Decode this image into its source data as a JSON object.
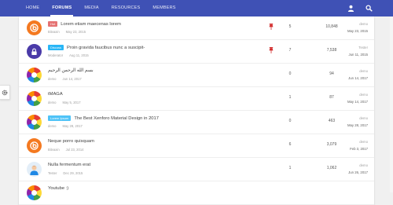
{
  "nav": {
    "items": [
      {
        "label": "HOME",
        "active": false
      },
      {
        "label": "FORUMS",
        "active": true
      },
      {
        "label": "MEDIA",
        "active": false
      },
      {
        "label": "RESOURCES",
        "active": false
      },
      {
        "label": "MEMBERS",
        "active": false
      }
    ],
    "icons": [
      "user-icon",
      "search-icon"
    ]
  },
  "side_toggle_icon": "gear-icon",
  "threads": [
    {
      "avatar": "orange-b",
      "prefix": "Hot",
      "prefix_color": "#e57373",
      "title": "Lorem etiam maecenas lorem",
      "author": "Bitvaxin",
      "date": "May 23, 2015",
      "pinned": true,
      "replies": "5",
      "views": "10,848",
      "last_user": "demo",
      "last_date": "May 23, 2015"
    },
    {
      "avatar": "purple-lock",
      "prefix": "Discuss",
      "prefix_color": "#29b6f6",
      "title": "Proin gravida faucibus nunc a suscipit-",
      "author": "Moderator",
      "date": "Aug 11, 2015",
      "pinned": true,
      "replies": "7",
      "views": "7,538",
      "last_user": "Tester",
      "last_date": "Jun 11, 2015"
    },
    {
      "avatar": "colorful",
      "prefix": "",
      "prefix_color": "",
      "title": "بسم الله الرحمن الرحيم",
      "author": "demo",
      "date": "Jun 14, 2017",
      "pinned": false,
      "replies": "0",
      "views": "94",
      "last_user": "demo",
      "last_date": "Jun 14, 2017"
    },
    {
      "avatar": "colorful",
      "prefix": "",
      "prefix_color": "",
      "title": "tMAGA",
      "author": "demo",
      "date": "May 5, 2017",
      "pinned": false,
      "replies": "1",
      "views": "87",
      "last_user": "demo",
      "last_date": "May 14, 2017"
    },
    {
      "avatar": "colorful",
      "prefix": "Lorem Ipsum",
      "prefix_color": "#4fc3f7",
      "title": "The Best Xenforo Material Design in 2017",
      "author": "demo",
      "date": "May 28, 2017",
      "pinned": false,
      "replies": "0",
      "views": "463",
      "last_user": "demo",
      "last_date": "May 28, 2017"
    },
    {
      "avatar": "orange-b",
      "prefix": "",
      "prefix_color": "",
      "title": "Neque porro quisquam",
      "author": "Bitvaxin",
      "date": "Jul 23, 2014",
      "pinned": false,
      "replies": "6",
      "views": "3,079",
      "last_user": "demo",
      "last_date": "Feb 3, 2017"
    },
    {
      "avatar": "person",
      "prefix": "",
      "prefix_color": "",
      "title": "Nulla fermentum erat",
      "author": "Tester",
      "date": "Dec 29, 2015",
      "pinned": false,
      "replies": "1",
      "views": "1,062",
      "last_user": "demo",
      "last_date": "Jun 26, 2017"
    },
    {
      "avatar": "colorful",
      "prefix": "",
      "prefix_color": "",
      "title": "Youtube :)",
      "author": "",
      "date": "",
      "pinned": false,
      "replies": "",
      "views": "",
      "last_user": "",
      "last_date": ""
    }
  ]
}
